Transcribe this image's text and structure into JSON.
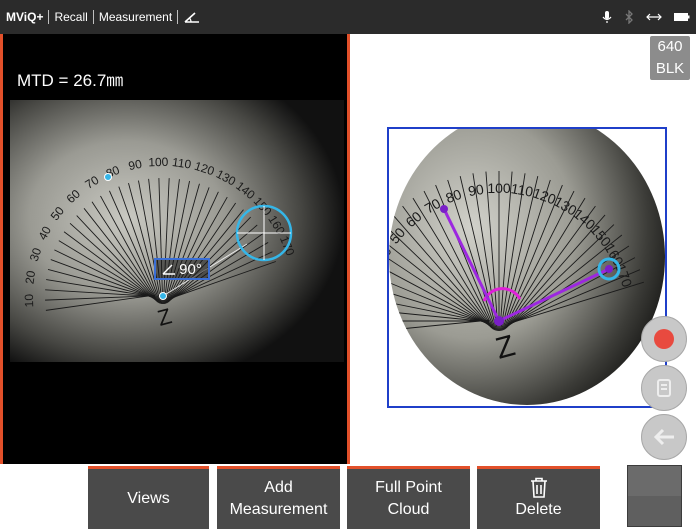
{
  "topbar": {
    "app": "MViQ+",
    "recall": "Recall",
    "measurement": "Measurement",
    "angle_tool_icon": "angle-icon",
    "status_icons": [
      "microphone-icon",
      "bluetooth-icon",
      "connection-icon",
      "battery-icon"
    ]
  },
  "left_view": {
    "mtd_label": "MTD = 26.7㎜",
    "angle_value": "90°",
    "angle_icon": "angle-icon"
  },
  "right_view": {
    "resolution": "640",
    "mode": "BLK"
  },
  "protractor": {
    "ticks": [
      "10",
      "20",
      "30",
      "40",
      "50",
      "60",
      "70",
      "80",
      "90",
      "100",
      "110",
      "120",
      "130",
      "140",
      "150",
      "160",
      "170"
    ]
  },
  "side_buttons": [
    "record-icon",
    "copy-icon",
    "back-icon"
  ],
  "toolbar": {
    "views": "Views",
    "add_line1": "Add",
    "add_line2": "Measurement",
    "cloud_line1": "Full Point",
    "cloud_line2": "Cloud",
    "delete": "Delete",
    "delete_icon": "trash-icon"
  },
  "colors": {
    "accent": "#e2502a",
    "frame": "#1f3fc9",
    "cursor": "#35b6e8",
    "measure_line": "#9c27e0",
    "angle_arc": "#e020d8"
  }
}
